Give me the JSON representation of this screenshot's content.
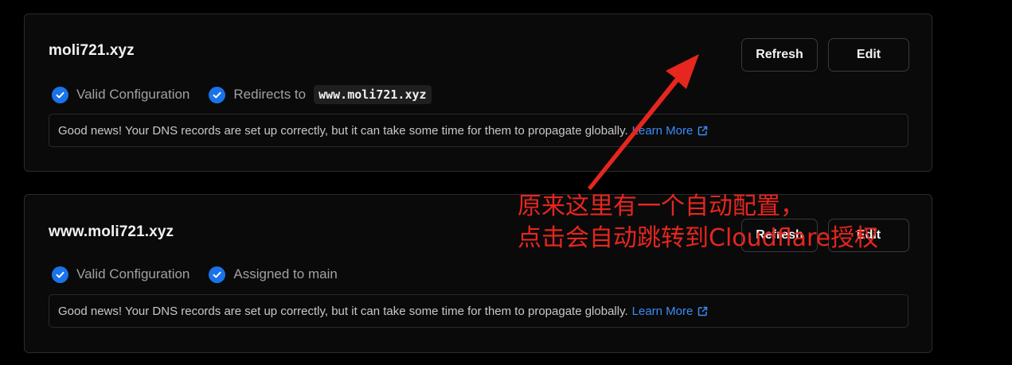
{
  "colors": {
    "background": "#000000",
    "card": "#0a0a0a",
    "border": "#2b2b2b",
    "check": "#1a73e8",
    "link": "#3b8cf7",
    "annotation": "#e6261f"
  },
  "domains": [
    {
      "name": "moli721.xyz",
      "refresh_label": "Refresh",
      "edit_label": "Edit",
      "status_1": "Valid Configuration",
      "status_2": "Redirects to",
      "redirect_target": "www.moli721.xyz",
      "info_text": "Good news! Your DNS records are set up correctly, but it can take some time for them to propagate globally.",
      "learn_more": "Learn More"
    },
    {
      "name": "www.moli721.xyz",
      "refresh_label": "Refresh",
      "edit_label": "Edit",
      "status_1": "Valid Configuration",
      "status_2": "Assigned to main",
      "info_text": "Good news! Your DNS records are set up correctly, but it can take some time for them to propagate globally.",
      "learn_more": "Learn More"
    }
  ],
  "annotation": {
    "line_1": "原来这里有一个自动配置，",
    "line_2": "点击会自动跳转到Cloudflare授权"
  }
}
